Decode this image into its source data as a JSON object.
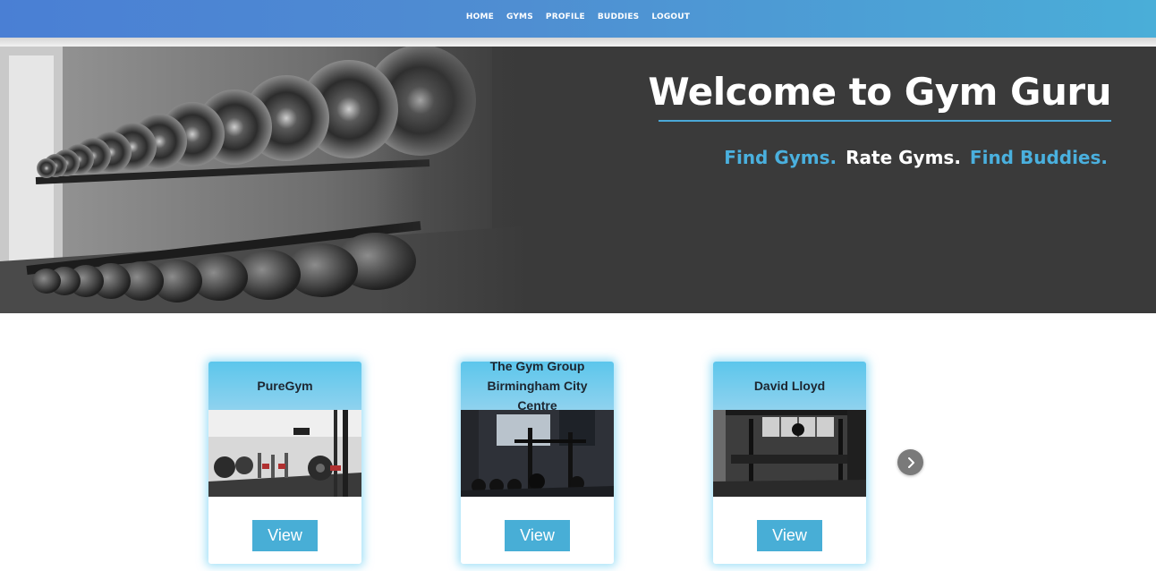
{
  "nav": {
    "links": [
      {
        "label": "HOME"
      },
      {
        "label": "GYMS"
      },
      {
        "label": "PROFILE"
      },
      {
        "label": "BUDDIES"
      },
      {
        "label": "LOGOUT"
      }
    ]
  },
  "hero": {
    "title": "Welcome to Gym Guru",
    "tagline": {
      "part1": "Find Gyms.",
      "part2": "Rate Gyms.",
      "part3": "Find Buddies."
    }
  },
  "gyms": [
    {
      "name": "PureGym",
      "button": "View",
      "image_icon": "gym-interior-photo"
    },
    {
      "name": "The Gym Group Birmingham City Centre",
      "button": "View",
      "image_icon": "gym-interior-photo"
    },
    {
      "name": "David Lloyd",
      "button": "View",
      "image_icon": "gym-interior-photo"
    }
  ],
  "carousel": {
    "next_icon": "chevron-right-icon"
  },
  "colors": {
    "nav_start": "#4a7fd4",
    "nav_end": "#4aaed8",
    "accent_blue": "#4ab0de",
    "hero_bg": "#3a3a3a",
    "button": "#48aed6",
    "card_header": "#5cc6ec"
  }
}
